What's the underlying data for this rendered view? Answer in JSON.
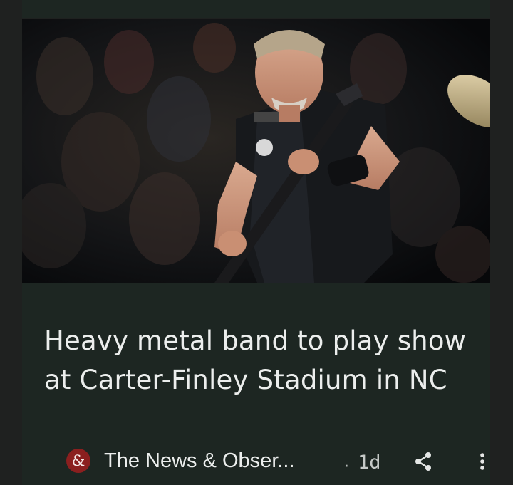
{
  "article": {
    "headline": "Heavy metal band to play show at Carter-Finley Stadium in NC",
    "source": {
      "logo_glyph": "&",
      "name": "The News & Obser...",
      "logo_color": "#8b1f1f"
    },
    "separator": "·",
    "age": "1d",
    "actions": {
      "share_icon": "share-icon",
      "more_icon": "more-vert-icon"
    }
  },
  "theme": {
    "card_background": "#1d2622",
    "text_color": "#eceeed"
  }
}
